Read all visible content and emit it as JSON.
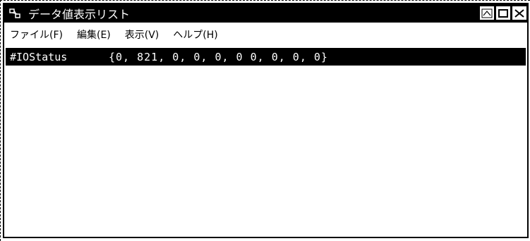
{
  "window": {
    "title": "データ値表示リスト",
    "buttons": {
      "minimize_icon": "minimize-icon",
      "maximize_icon": "maximize-icon",
      "close_icon": "close-icon"
    }
  },
  "menubar": {
    "items": [
      {
        "label": "ファイル(F)"
      },
      {
        "label": "編集(E)"
      },
      {
        "label": "表示(V)"
      },
      {
        "label": "ヘルプ(H)"
      }
    ]
  },
  "list": {
    "rows": [
      {
        "name": "#IOStatus",
        "value": "{0, 821, 0, 0, 0, 0 0, 0, 0, 0}",
        "selected": true
      }
    ]
  }
}
